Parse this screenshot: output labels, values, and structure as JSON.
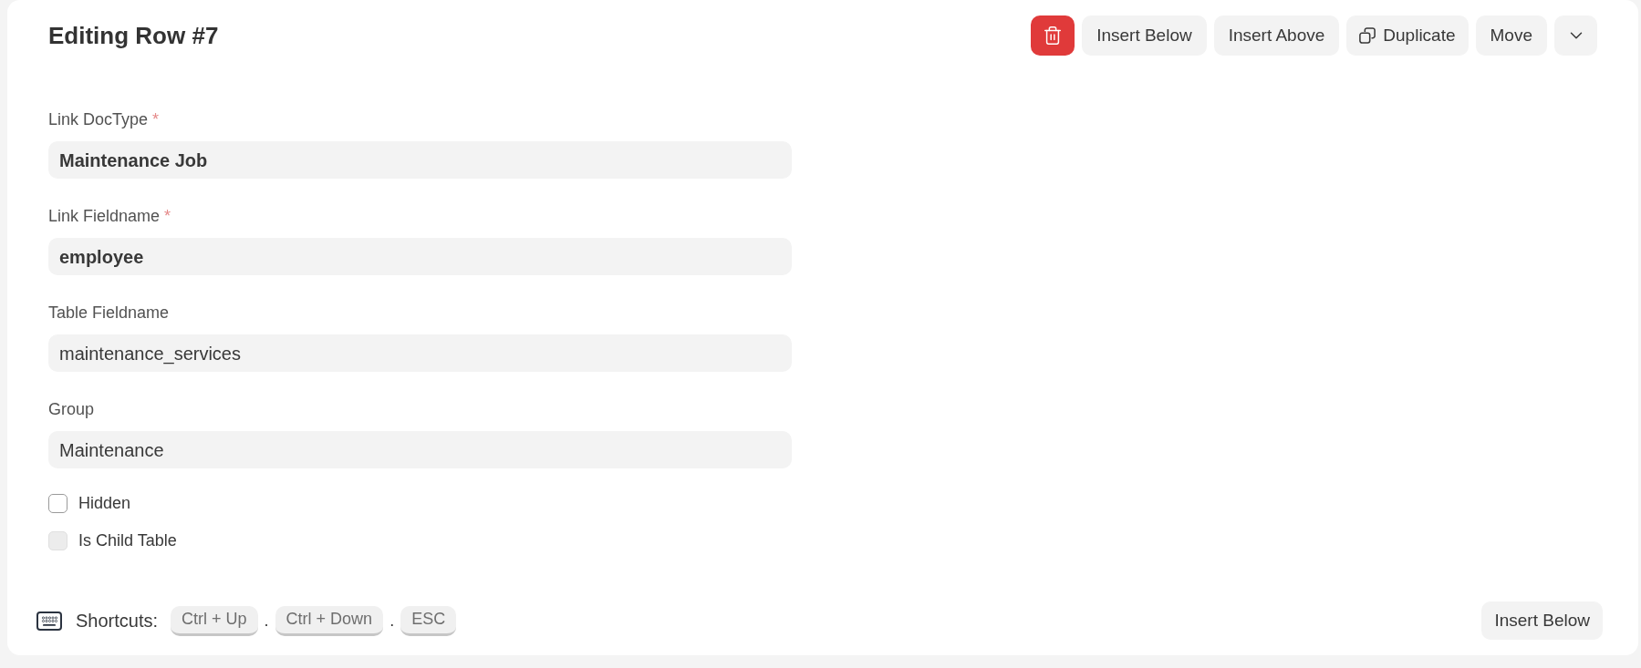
{
  "header": {
    "title": "Editing Row #7",
    "actions": [
      {
        "kind": "delete"
      },
      {
        "kind": "text",
        "label": "Insert Below"
      },
      {
        "kind": "text",
        "label": "Insert Above"
      },
      {
        "kind": "icon_text",
        "label": "Duplicate"
      },
      {
        "kind": "text",
        "label": "Move"
      },
      {
        "kind": "menu"
      }
    ]
  },
  "fields": [
    {
      "label": "Link DocType",
      "required_mark": "*",
      "kind": "link",
      "value": "Maintenance Job"
    },
    {
      "label": "Link Fieldname",
      "required_mark": "*",
      "kind": "link",
      "value": "employee"
    },
    {
      "label": "Table Fieldname",
      "kind": "data",
      "value": "maintenance_services"
    },
    {
      "label": "Group",
      "kind": "data",
      "value": "Maintenance"
    }
  ],
  "checkboxes": [
    {
      "label": "Hidden",
      "checked": false,
      "disabled": false
    },
    {
      "label": "Is Child Table",
      "checked": false,
      "disabled": true
    }
  ],
  "footer": {
    "shortcuts_label": "Shortcuts:",
    "shortcuts": [
      {
        "kind": "key",
        "text": "Ctrl + Up"
      },
      {
        "kind": "separator",
        "text": "."
      },
      {
        "kind": "key",
        "text": "Ctrl + Down"
      },
      {
        "kind": "separator",
        "text": "."
      },
      {
        "kind": "key",
        "text": "ESC"
      }
    ],
    "button": "Insert Below"
  }
}
